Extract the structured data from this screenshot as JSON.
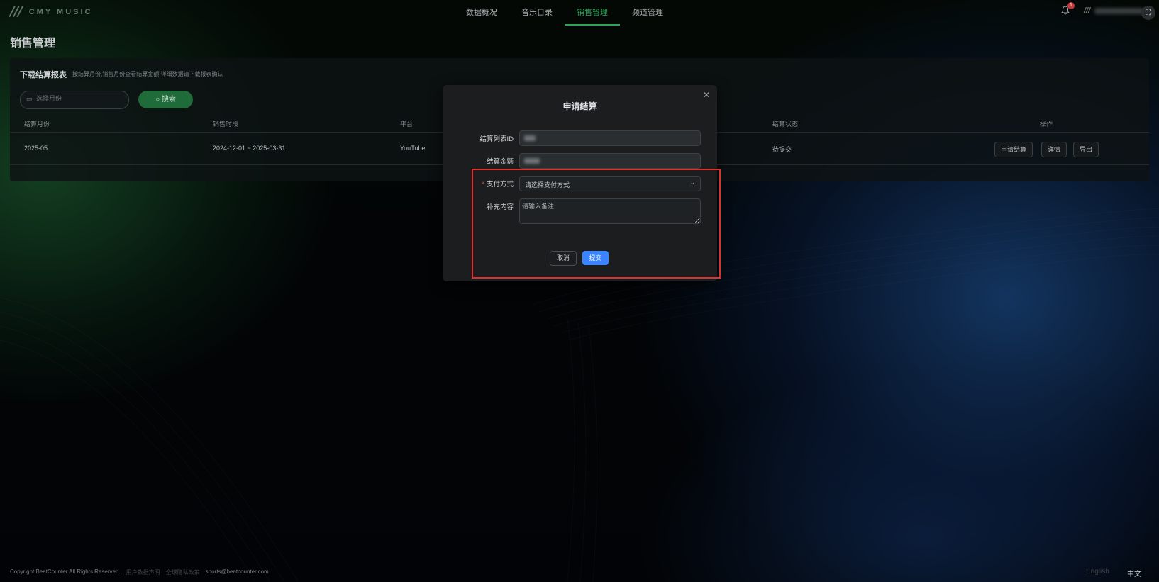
{
  "app": {
    "logo_text": "CMY MUSIC"
  },
  "nav": {
    "items": [
      {
        "label": "数据概况",
        "active": false
      },
      {
        "label": "音乐目录",
        "active": false
      },
      {
        "label": "销售管理",
        "active": true
      },
      {
        "label": "频道管理",
        "active": false
      }
    ],
    "notification_count": "1"
  },
  "page": {
    "title": "销售管理"
  },
  "report_card": {
    "title": "下载结算报表",
    "hint": "按结算月份,销售月份查看结算金额,详细数据请下载报表确认",
    "month_placeholder": "选择月份",
    "search_label": "搜索",
    "columns": [
      "结算月份",
      "销售时段",
      "平台",
      "结算状态",
      "操作"
    ],
    "rows": [
      {
        "month": "2025-05",
        "period": "2024-12-01 ~ 2025-03-31",
        "platform": "YouTube",
        "status": "待提交"
      }
    ],
    "actions": [
      "申请结算",
      "详情",
      "导出"
    ]
  },
  "modal": {
    "title": "申请结算",
    "fields": {
      "list_id_label": "结算列表ID",
      "amount_label": "结算金额",
      "payment_label": "支付方式",
      "payment_placeholder": "请选择支付方式",
      "remark_label": "补充内容",
      "remark_placeholder": "请输入备注"
    },
    "cancel_label": "取消",
    "submit_label": "提交"
  },
  "footer": {
    "copyright": "Copyright BeatCounter All Rights Reserved.",
    "link1": "用户数据声明",
    "link2": "全球隐私政策",
    "email": "shorts@beatcounter.com",
    "lang_en": "English",
    "lang_zh": "中文"
  },
  "colors": {
    "accent_green": "#2da35a",
    "primary_blue": "#3a84ff",
    "highlight_red": "#e0302c"
  }
}
